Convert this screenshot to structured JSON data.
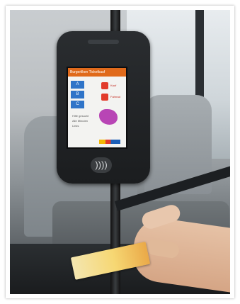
{
  "screen": {
    "header": "Burgerliken Ticketkauf",
    "menu_buttons": [
      "A",
      "B",
      "C"
    ],
    "tile_labels": [
      "Kauf",
      "Fahrrad"
    ],
    "list_lines": [
      "Hilfe gesucht",
      "Alle Minuten",
      "Links"
    ]
  },
  "device": {
    "contactless_icon": "contactless-payment-icon"
  },
  "colors": {
    "header_orange": "#e06a1b",
    "button_blue": "#2f74c8",
    "tile_red": "#e23b2b",
    "map_purple": "#b845b5",
    "card_gold": "#f6d773"
  }
}
